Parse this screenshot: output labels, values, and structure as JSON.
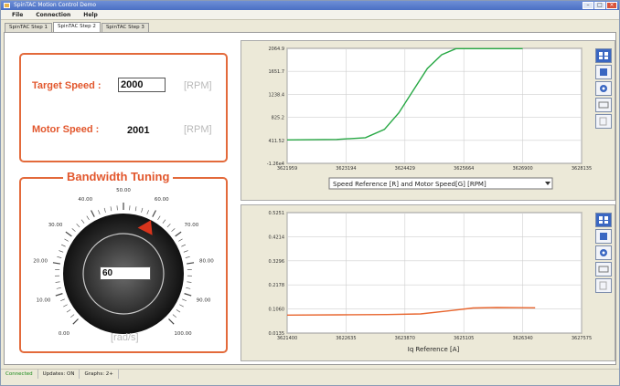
{
  "window": {
    "title": "SpinTAC Motion Control Demo"
  },
  "menu": {
    "items": [
      "File",
      "Connection",
      "Help"
    ]
  },
  "tabs": [
    "SpinTAC Step 1",
    "SpinTAC Step 2",
    "SpinTAC Step 3"
  ],
  "active_tab": 1,
  "speed": {
    "target_label": "Target Speed :",
    "target_value": "2000",
    "target_unit": "[RPM]",
    "motor_label": "Motor Speed :",
    "motor_value": "2001",
    "motor_unit": "[RPM]"
  },
  "bandwidth": {
    "title": "Bandwidth Tuning",
    "value": "60",
    "unit": "[rad/s]",
    "knob": {
      "min": 0,
      "max": 100,
      "value": 60
    },
    "scale_labels": [
      "0.00",
      "10.00",
      "20.00",
      "30.00",
      "40.00",
      "50.00",
      "60.00",
      "70.00",
      "80.00",
      "90.00",
      "100.00"
    ]
  },
  "plots": {
    "buttons": [
      "zoom-in-icon",
      "zoom-out-icon",
      "pan-icon",
      "window-icon",
      "copy-icon"
    ],
    "top_dropdown": "Speed Reference [R] and Motor Speed[G] [RPM]",
    "bottom_label": "Iq Reference [A]"
  },
  "chart_data": [
    {
      "type": "line",
      "title": "",
      "xlabel": "Speed Reference [R] and Motor Speed[G] [RPM]",
      "ylabel": "",
      "x_ticks": [
        "3621959",
        "3623194",
        "3624429",
        "3625664",
        "3626900",
        "3628135"
      ],
      "y_ticks": [
        "-1.26e4",
        "411.52",
        "825.2",
        "1238.4",
        "1651.7",
        "2064.9"
      ],
      "ylim": [
        -12.6,
        2064.9
      ],
      "xlim": [
        3621959,
        3628135
      ],
      "grid": true,
      "series": [
        {
          "color": "#27a844",
          "x": [
            3621959,
            3623000,
            3623600,
            3624000,
            3624300,
            3624600,
            3624900,
            3625200,
            3625500,
            3626900
          ],
          "y": [
            411.52,
            420,
            450,
            600,
            900,
            1300,
            1700,
            1950,
            2060,
            2060
          ]
        }
      ]
    },
    {
      "type": "line",
      "title": "",
      "xlabel": "Iq Reference [A]",
      "ylabel": "",
      "x_ticks": [
        "3621400",
        "3622635",
        "3623870",
        "3625105",
        "3626340",
        "3627575"
      ],
      "y_ticks": [
        "0.0135",
        "0.1060",
        "0.2178",
        "0.3296",
        "0.4214",
        "0.5251"
      ],
      "ylim": [
        0.0135,
        0.5251
      ],
      "xlim": [
        3621400,
        3627575
      ],
      "grid": true,
      "series": [
        {
          "color": "#e8662f",
          "x": [
            3621400,
            3622500,
            3623500,
            3624200,
            3624800,
            3625300,
            3625800,
            3626600
          ],
          "y": [
            0.09,
            0.091,
            0.092,
            0.095,
            0.108,
            0.12,
            0.122,
            0.121
          ]
        }
      ]
    }
  ],
  "status": {
    "connected": "Connected",
    "updates": "Updates: ON",
    "graphs": "Graphs: 2+"
  }
}
